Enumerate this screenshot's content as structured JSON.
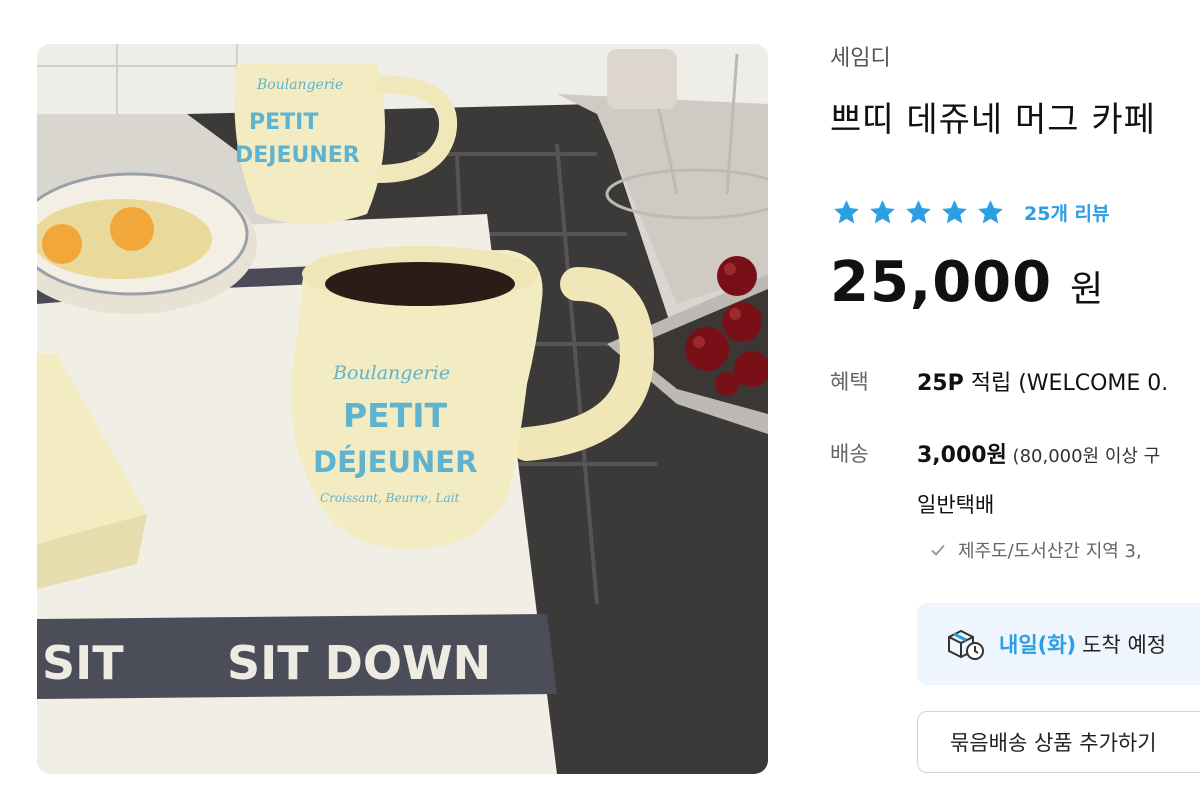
{
  "product": {
    "brand": "세임디",
    "title": "쁘띠 데쥬네 머그 카페",
    "rating_stars": 5,
    "review_count": "25개 리뷰",
    "price": "25,000",
    "price_unit": "원"
  },
  "photo": {
    "mug_text_line1": "Boulangerie",
    "mug_text_line2": "PETIT",
    "mug_text_line3": "DÉJEUNER",
    "mug_text_line4": "Croissant, Beurre, Lait",
    "pitcher_text_line1": "Boulangerie",
    "pitcher_text_line2": "PETIT",
    "pitcher_text_line3": "DEJEUNER",
    "towel_text": "SIT DOWN",
    "towel_text_left": "SIT"
  },
  "benefit": {
    "label": "혜택",
    "points": "25P",
    "text": " 적립 (WELCOME 0."
  },
  "shipping": {
    "label": "배송",
    "fee": "3,000원",
    "condition": " (80,000원 이상 구",
    "method": "일반택배",
    "note": "제주도/도서산간 지역 3,"
  },
  "arrival": {
    "day": "내일(화)",
    "text": "도착 예정"
  },
  "bundle": {
    "label": "묶음배송 상품 추가하기"
  },
  "colors": {
    "accent": "#2c9ee3",
    "star": "#2c9ee3",
    "arrival_bg": "#eef5fc",
    "mug_text": "#5fb3cf",
    "mug_body": "#f3ecc2"
  },
  "icons": {
    "star": "star-icon",
    "check": "check-icon",
    "delivery": "delivery-box-clock-icon"
  }
}
